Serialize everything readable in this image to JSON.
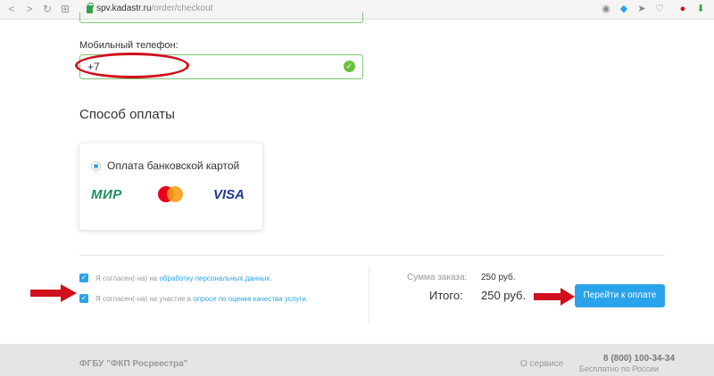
{
  "browser": {
    "url_domain": "spv.kadastr.ru",
    "url_path": "/order/checkout",
    "back_icon": "<",
    "forward_icon": ">",
    "grid_icon": "⊞"
  },
  "contact": {
    "phone_label": "Мобильный телефон:",
    "phone_value": "+7"
  },
  "payment": {
    "section_title": "Способ оплаты",
    "method_label": "Оплата банковской картой",
    "logos": {
      "mir": "МИР",
      "visa": "VISA"
    }
  },
  "agreements": [
    {
      "prefix": "Я согласен(-на) на ",
      "link": "обработку персональных данных",
      "suffix": ".",
      "checked": true
    },
    {
      "prefix": "Я согласен(-на) на участие в ",
      "link": "опросе по оценке качества услуги",
      "suffix": ".",
      "checked": true
    }
  ],
  "summary": {
    "order_sum_label": "Сумма заказа:",
    "order_sum_value": "250 руб.",
    "total_label": "Итого:",
    "total_value": "250 руб.",
    "pay_button": "Перейти к оплате"
  },
  "footer": {
    "org": "ФГБУ \"ФКП Росреестра\"",
    "about": "О сервисе",
    "phone": "8 (800) 100-34-34",
    "free_note": "Бесплатно по России"
  },
  "colors": {
    "accent": "#2aa3ea",
    "valid_green": "#6cbf3f",
    "annotation_red": "#d0101c"
  }
}
